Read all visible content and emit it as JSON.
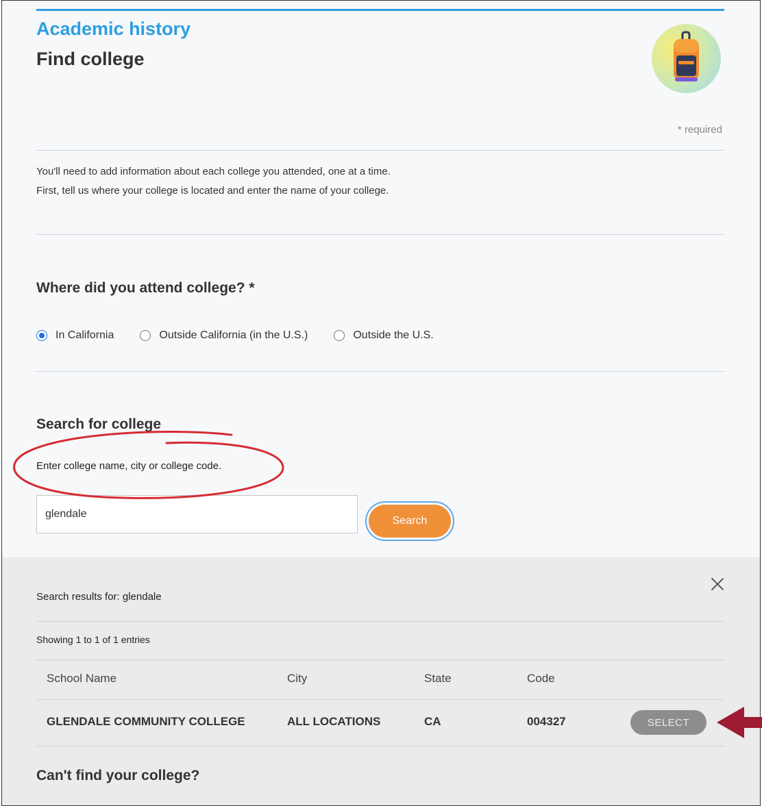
{
  "header": {
    "section_label": "Academic history",
    "page_title": "Find college",
    "required_note": "* required"
  },
  "intro": {
    "line1": "You'll need to add information about each college you attended, one at a time.",
    "line2": "First, tell us where your college is located and enter the name of your college."
  },
  "location": {
    "question": "Where did you attend college? *",
    "options": [
      {
        "label": "In California",
        "checked": true
      },
      {
        "label": "Outside California (in the U.S.)",
        "checked": false
      },
      {
        "label": "Outside the U.S.",
        "checked": false
      }
    ]
  },
  "search": {
    "heading": "Search for college",
    "hint": "Enter college name, city or college code.",
    "value": "glendale",
    "button_label": "Search"
  },
  "results": {
    "results_for": "Search results for: glendale",
    "showing": "Showing 1 to 1 of 1 entries",
    "columns": [
      "School Name",
      "City",
      "State",
      "Code"
    ],
    "rows": [
      {
        "school": "GLENDALE COMMUNITY COLLEGE",
        "city": "ALL LOCATIONS",
        "state": "CA",
        "code": "004327",
        "action": "SELECT"
      }
    ],
    "cant_find": "Can't find your college?"
  },
  "colors": {
    "accent_blue": "#2d9ee0",
    "search_orange": "#f0913a",
    "annotation_red": "#d42c34",
    "arrow_maroon": "#9e1b32"
  },
  "icons": {
    "badge": "backpack-icon",
    "close": "close-icon",
    "annotation_arrow": "arrow-left-icon"
  }
}
